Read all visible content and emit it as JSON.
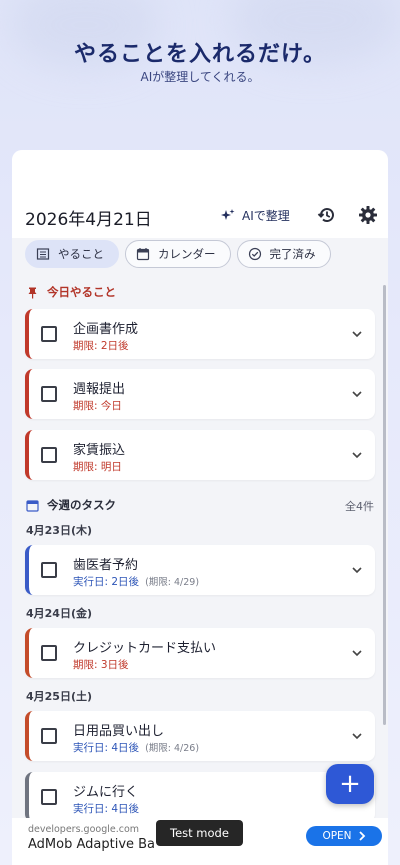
{
  "hero": {
    "title": "やることを入れるだけ。",
    "subtitle": "AIが整理してくれる。"
  },
  "header": {
    "date": "2026年4月21日",
    "ai_label": "AIで整理",
    "icons": [
      "sparkle-icon",
      "history-icon",
      "gear-icon"
    ]
  },
  "tabs": [
    {
      "label": "やること",
      "icon": "list-icon",
      "active": true
    },
    {
      "label": "カレンダー",
      "icon": "calendar-icon",
      "active": false
    },
    {
      "label": "完了済み",
      "icon": "check-circle-icon",
      "active": false
    }
  ],
  "today": {
    "heading": "今日やること",
    "tasks": [
      {
        "title": "企画書作成",
        "meta": "期限: 2日後"
      },
      {
        "title": "週報提出",
        "meta": "期限: 今日"
      },
      {
        "title": "家賃振込",
        "meta": "期限: 明日"
      }
    ]
  },
  "week": {
    "heading": "今週のタスク",
    "count": "全4件",
    "days": [
      {
        "label": "4月23日(木)",
        "tasks": [
          {
            "title": "歯医者予約",
            "meta": "実行日: 2日後",
            "sub": "(期限: 4/29)"
          }
        ]
      },
      {
        "label": "4月24日(金)",
        "tasks": [
          {
            "title": "クレジットカード支払い",
            "meta": "期限: 3日後"
          }
        ]
      },
      {
        "label": "4月25日(土)",
        "tasks": [
          {
            "title": "日用品買い出し",
            "meta": "実行日: 4日後",
            "sub": "(期限: 4/26)"
          },
          {
            "title": "ジムに行く",
            "meta": "実行日: 4日後"
          }
        ]
      }
    ]
  },
  "fab": {
    "label": "+"
  },
  "ad": {
    "url": "developers.google.com",
    "title": "AdMob Adaptive Ba",
    "test_mode": "Test mode",
    "open": "OPEN"
  },
  "colors": {
    "accent": "#2e58d6",
    "today_heading": "#b23428",
    "deadline_red": "#c0392b",
    "exec_blue": "#2d55b7"
  }
}
